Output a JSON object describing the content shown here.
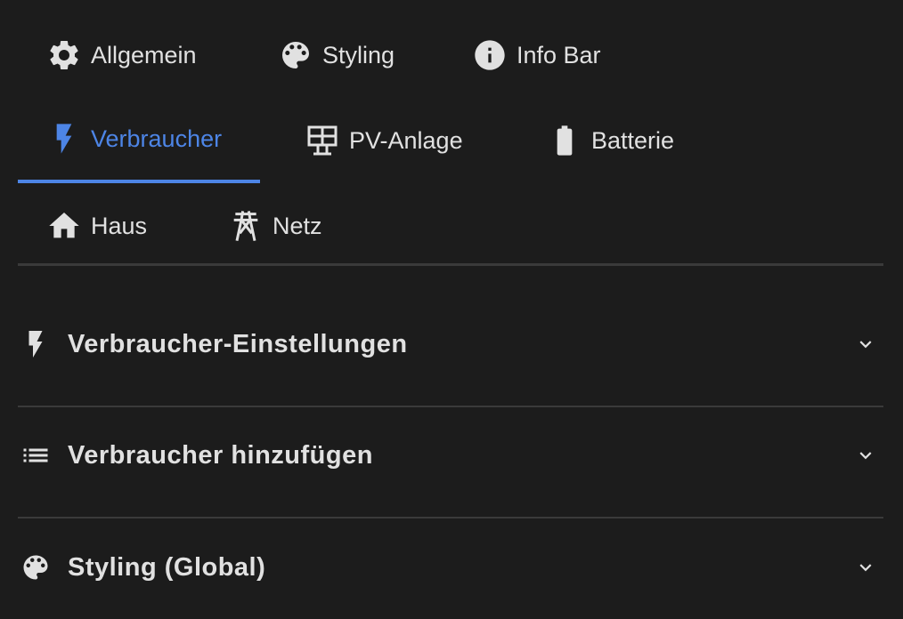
{
  "tabs": [
    {
      "label": "Allgemein",
      "icon": "gear-icon",
      "active": false
    },
    {
      "label": "Styling",
      "icon": "palette-icon",
      "active": false
    },
    {
      "label": "Info Bar",
      "icon": "info-icon",
      "active": false
    },
    {
      "label": "Verbraucher",
      "icon": "lightning-icon",
      "active": true
    },
    {
      "label": "PV-Anlage",
      "icon": "solar-panel-icon",
      "active": false
    },
    {
      "label": "Batterie",
      "icon": "battery-icon",
      "active": false
    },
    {
      "label": "Haus",
      "icon": "home-icon",
      "active": false
    },
    {
      "label": "Netz",
      "icon": "power-tower-icon",
      "active": false
    }
  ],
  "sections": [
    {
      "title": "Verbraucher-Einstellungen",
      "icon": "lightning-icon"
    },
    {
      "title": "Verbraucher hinzufügen",
      "icon": "list-icon"
    },
    {
      "title": "Styling (Global)",
      "icon": "palette-icon"
    }
  ],
  "colors": {
    "background": "#1c1c1c",
    "text": "#e1e1e1",
    "accent": "#4d85e6",
    "divider": "#3a3a3a"
  }
}
